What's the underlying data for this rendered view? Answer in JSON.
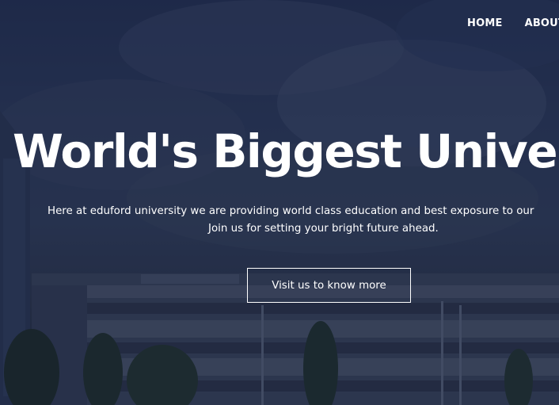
{
  "nav": {
    "items": [
      {
        "label": "HOME"
      },
      {
        "label": "ABOUT"
      }
    ]
  },
  "hero": {
    "headline": "World's Biggest Univer",
    "subtext_line1": "Here at eduford university we are providing world class education and best exposure to our",
    "subtext_line2": "Join us for setting your bright future ahead.",
    "cta_label": "Visit us to know more"
  },
  "colors": {
    "text": "#ffffff",
    "overlay": "#1f2b45"
  }
}
